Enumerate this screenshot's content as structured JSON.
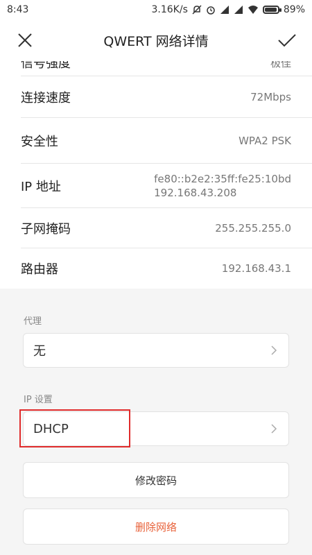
{
  "status_bar": {
    "time": "8:43",
    "speed": "3.16K/s",
    "battery": "89%",
    "icons": [
      "mute-icon",
      "alarm-icon",
      "signal-icon",
      "signal-icon",
      "wifi-icon",
      "battery-icon"
    ]
  },
  "header": {
    "title": "QWERT  网络详情",
    "close_icon": "close-icon",
    "confirm_icon": "check-icon"
  },
  "details": {
    "partial_row": {
      "label": "信号强度",
      "value": "极佳"
    },
    "rows": [
      {
        "label": "连接速度",
        "value": "72Mbps"
      },
      {
        "label": "安全性",
        "value": "WPA2 PSK"
      },
      {
        "label": "IP 地址",
        "value": "fe80::b2e2:35ff:fe25:10bd",
        "value2": "192.168.43.208"
      },
      {
        "label": "子网掩码",
        "value": "255.255.255.0"
      },
      {
        "label": "路由器",
        "value": "192.168.43.1"
      }
    ]
  },
  "proxy": {
    "label": "代理",
    "value": "无"
  },
  "ip_settings": {
    "label": "IP 设置",
    "value": "DHCP"
  },
  "actions": {
    "modify_password": "修改密码",
    "delete_network": "删除网络",
    "danger_color": "#e8623a"
  }
}
